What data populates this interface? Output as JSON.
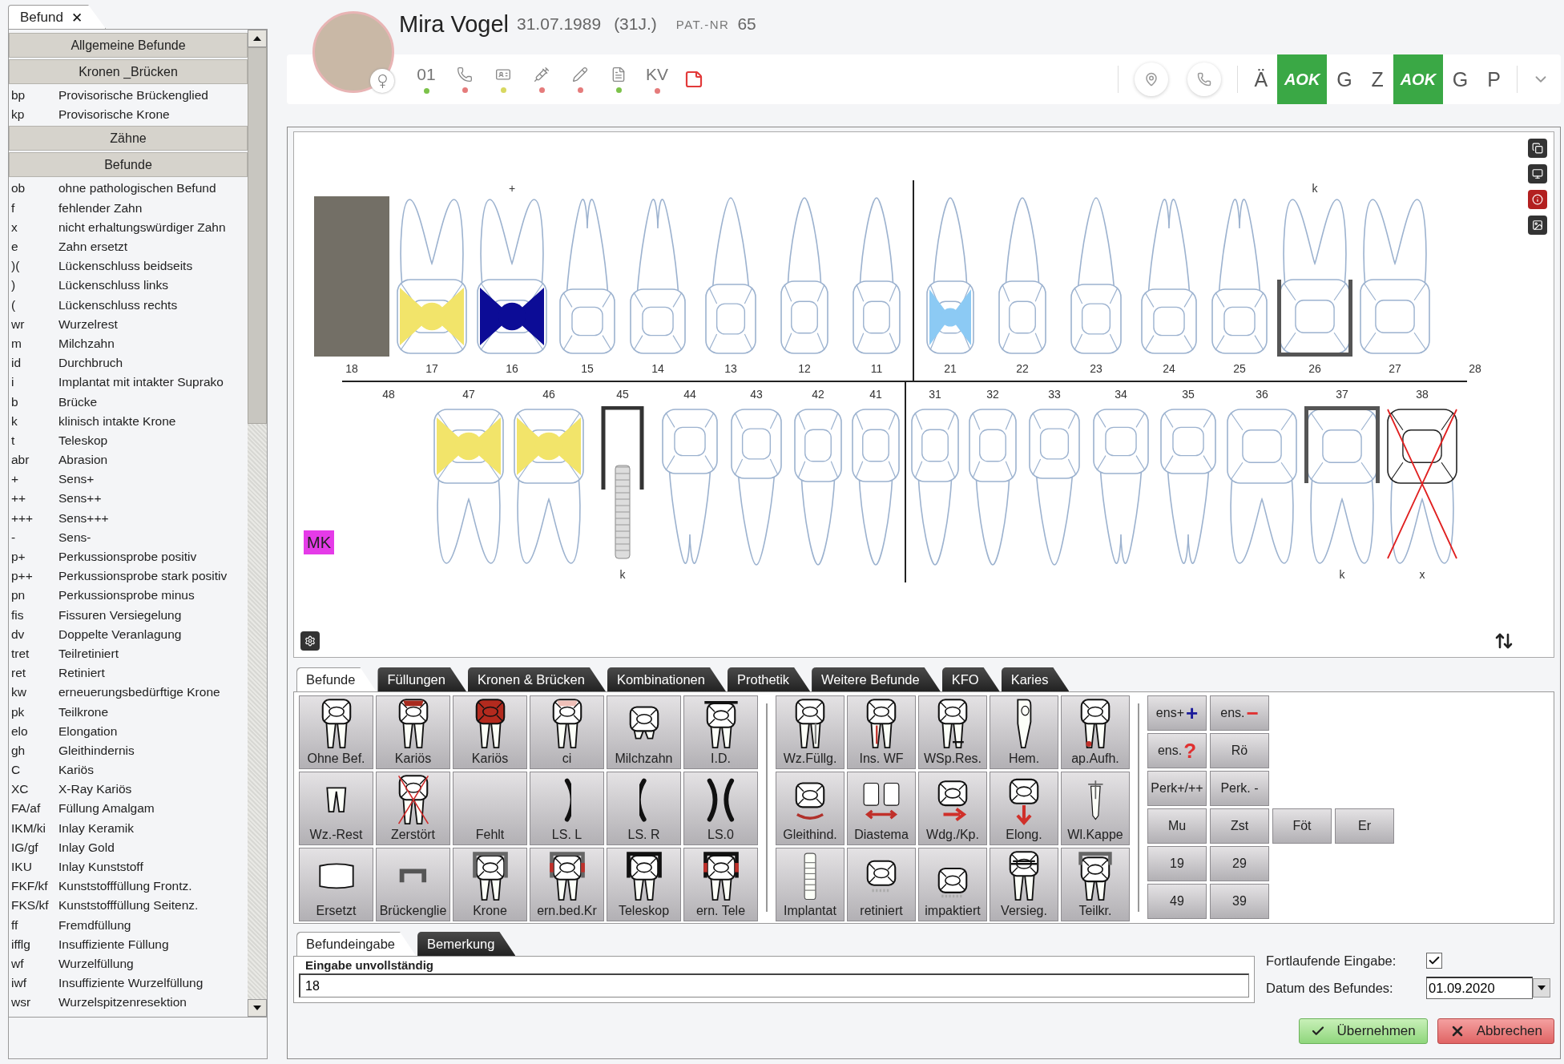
{
  "sidebar": {
    "tab": {
      "label": "Befund",
      "close": "✕"
    },
    "sections": [
      {
        "title": "Allgemeine Befunde"
      },
      {
        "title": "Kronen _Brücken",
        "items": [
          {
            "code": "bp",
            "label": "Provisorische Brückenglied"
          },
          {
            "code": "kp",
            "label": "Provisorische Krone"
          }
        ]
      },
      {
        "title": "Zähne"
      },
      {
        "title": "Befunde",
        "items": [
          {
            "code": "ob",
            "label": "ohne pathologischen Befund"
          },
          {
            "code": "f",
            "label": "fehlender Zahn"
          },
          {
            "code": "x",
            "label": "nicht erhaltungswürdiger Zahn"
          },
          {
            "code": "e",
            "label": "Zahn ersetzt"
          },
          {
            "code": ")(",
            "label": "Lückenschluss beidseits"
          },
          {
            "code": ")",
            "label": "Lückenschluss links"
          },
          {
            "code": "(",
            "label": "Lückenschluss rechts"
          },
          {
            "code": "wr",
            "label": "Wurzelrest"
          },
          {
            "code": "m",
            "label": "Milchzahn"
          },
          {
            "code": "id",
            "label": "Durchbruch"
          },
          {
            "code": "i",
            "label": "Implantat mit intakter Suprako"
          },
          {
            "code": "b",
            "label": "Brücke"
          },
          {
            "code": "k",
            "label": "klinisch intakte Krone"
          },
          {
            "code": "t",
            "label": "Teleskop"
          },
          {
            "code": "abr",
            "label": "Abrasion"
          },
          {
            "code": "+",
            "label": "Sens+"
          },
          {
            "code": "++",
            "label": "Sens++"
          },
          {
            "code": "+++",
            "label": "Sens+++"
          },
          {
            "code": "-",
            "label": "Sens-"
          },
          {
            "code": "p+",
            "label": "Perkussionsprobe positiv"
          },
          {
            "code": "p++",
            "label": "Perkussionsprobe stark positiv"
          },
          {
            "code": "pn",
            "label": "Perkussionsprobe minus"
          },
          {
            "code": "fis",
            "label": "Fissuren Versiegelung"
          },
          {
            "code": "dv",
            "label": "Doppelte Veranlagung"
          },
          {
            "code": "tret",
            "label": "Teilretiniert"
          },
          {
            "code": "ret",
            "label": "Retiniert"
          },
          {
            "code": "kw",
            "label": "erneuerungsbedürftige Krone"
          },
          {
            "code": "pk",
            "label": "Teilkrone"
          },
          {
            "code": "elo",
            "label": "Elongation"
          },
          {
            "code": "gh",
            "label": "Gleithindernis"
          },
          {
            "code": "C",
            "label": "Kariös"
          },
          {
            "code": "XC",
            "label": "X-Ray Kariös"
          },
          {
            "code": "FA/af",
            "label": "Füllung Amalgam"
          },
          {
            "code": "IKM/ki",
            "label": "Inlay Keramik"
          },
          {
            "code": "IG/gf",
            "label": "Inlay Gold"
          },
          {
            "code": "IKU",
            "label": "Inlay Kunststoff"
          },
          {
            "code": "FKF/kf",
            "label": "Kunststofffüllung Frontz."
          },
          {
            "code": "FKS/kf",
            "label": "Kunststofffüllung Seitenz."
          },
          {
            "code": "ff",
            "label": "Fremdfüllung"
          },
          {
            "code": "ifflg",
            "label": "Insuffiziente Füllung"
          },
          {
            "code": "wf",
            "label": "Wurzelfüllung"
          },
          {
            "code": "iwf",
            "label": "Insuffiziente Wurzelfüllung"
          },
          {
            "code": "wsr",
            "label": "Wurzelspitzenresektion"
          }
        ]
      }
    ]
  },
  "patient": {
    "name": "Mira Vogel",
    "birth_date": "31.07.1989",
    "age": "(31J.)",
    "number_label": "PAT.-NR",
    "number": "65"
  },
  "toolbar": {
    "items": [
      {
        "label": "01",
        "color": "#7cc24a"
      },
      {
        "color": "#e57b7b"
      },
      {
        "color": "#d8d860"
      },
      {
        "color": "#e57b7b"
      },
      {
        "color": "#e57b7b"
      },
      {
        "color": "#7cc24a"
      },
      {
        "label": "KV",
        "color": "#e57b7b"
      }
    ],
    "insurance": [
      {
        "kind": "letter",
        "label": "Ä"
      },
      {
        "kind": "logo",
        "label": "AOK"
      },
      {
        "kind": "letter",
        "label": "G"
      },
      {
        "kind": "letter",
        "label": "Z"
      },
      {
        "kind": "logo",
        "label": "AOK"
      },
      {
        "kind": "letter",
        "label": "G"
      },
      {
        "kind": "letter",
        "label": "P"
      }
    ]
  },
  "chart": {
    "badge": "MK",
    "upper_jaw": {
      "right": [
        {
          "number": "18",
          "kind": "marked"
        },
        {
          "number": "17",
          "kind": "filling",
          "color": "#f2e46a"
        },
        {
          "number": "16",
          "kind": "filling",
          "color": "#0c0c96",
          "mark": "+"
        },
        {
          "number": "15",
          "kind": "healthy"
        },
        {
          "number": "14",
          "kind": "healthy"
        },
        {
          "number": "13",
          "kind": "healthy"
        },
        {
          "number": "12",
          "kind": "healthy"
        },
        {
          "number": "11",
          "kind": "healthy"
        }
      ],
      "left": [
        {
          "number": "21",
          "kind": "filling",
          "color": "#8ccaf4"
        },
        {
          "number": "22",
          "kind": "healthy"
        },
        {
          "number": "23",
          "kind": "healthy"
        },
        {
          "number": "24",
          "kind": "healthy"
        },
        {
          "number": "25",
          "kind": "healthy"
        },
        {
          "number": "26",
          "kind": "crown",
          "mark": "k"
        },
        {
          "number": "27",
          "kind": "healthy"
        },
        {
          "number": "28",
          "kind": "missing"
        }
      ]
    },
    "lower_jaw": {
      "right": [
        {
          "number": "48",
          "kind": "missing"
        },
        {
          "number": "47",
          "kind": "filling",
          "color": "#f2e46a"
        },
        {
          "number": "46",
          "kind": "filling",
          "color": "#f2e46a"
        },
        {
          "number": "45",
          "kind": "implant",
          "mark": "k"
        },
        {
          "number": "44",
          "kind": "healthy"
        },
        {
          "number": "43",
          "kind": "healthy"
        },
        {
          "number": "42",
          "kind": "healthy"
        },
        {
          "number": "41",
          "kind": "healthy"
        }
      ],
      "left": [
        {
          "number": "31",
          "kind": "healthy"
        },
        {
          "number": "32",
          "kind": "healthy"
        },
        {
          "number": "33",
          "kind": "healthy"
        },
        {
          "number": "34",
          "kind": "healthy"
        },
        {
          "number": "35",
          "kind": "healthy"
        },
        {
          "number": "36",
          "kind": "healthy"
        },
        {
          "number": "37",
          "kind": "crown",
          "mark": "k"
        },
        {
          "number": "38",
          "kind": "extraction",
          "mark": "x"
        }
      ]
    }
  },
  "tabs": [
    {
      "label": "Befunde",
      "selected": true
    },
    {
      "label": "Füllungen",
      "selected": false
    },
    {
      "label": "Kronen & Brücken",
      "selected": false
    },
    {
      "label": "Kombinationen",
      "selected": false
    },
    {
      "label": "Prothetik",
      "selected": false
    },
    {
      "label": "Weitere Befunde",
      "selected": false
    },
    {
      "label": "KFO",
      "selected": false
    },
    {
      "label": "Karies",
      "selected": false
    }
  ],
  "finding_buttons": [
    {
      "label": "Ohne Bef.",
      "kind": "tooth"
    },
    {
      "label": "Kariös",
      "kind": "caries-top"
    },
    {
      "label": "Kariös",
      "kind": "caries-full"
    },
    {
      "label": "ci",
      "kind": "ci"
    },
    {
      "label": "Milchzahn",
      "kind": "milk"
    },
    {
      "label": "I.D.",
      "kind": "id"
    },
    {
      "label": "Wz.-Rest",
      "kind": "root-rest"
    },
    {
      "label": "Zerstört",
      "kind": "destroyed"
    },
    {
      "label": "Fehlt",
      "kind": "empty"
    },
    {
      "label": "LS. L",
      "kind": "close-left"
    },
    {
      "label": "LS. R",
      "kind": "close-right"
    },
    {
      "label": "LS.0",
      "kind": "close-both"
    },
    {
      "label": "Ersetzt",
      "kind": "replaced"
    },
    {
      "label": "Brückenglie",
      "kind": "bridge-link"
    },
    {
      "label": "Krone",
      "kind": "crown"
    },
    {
      "label": "ern.bed.Kr",
      "kind": "crown-renew"
    },
    {
      "label": "Teleskop",
      "kind": "telescope"
    },
    {
      "label": "ern. Tele",
      "kind": "telescope-renew"
    }
  ],
  "more_buttons": [
    {
      "label": "Wz.Füllg.",
      "kind": "root-fill"
    },
    {
      "label": "Ins. WF",
      "kind": "root-fill-bad"
    },
    {
      "label": "WSp.Res.",
      "kind": "resection"
    },
    {
      "label": "Hem.",
      "kind": "hemisection"
    },
    {
      "label": "ap.Aufh.",
      "kind": "apex"
    },
    {
      "label": "Gleithind.",
      "kind": "glide"
    },
    {
      "label": "Diastema",
      "kind": "diastema"
    },
    {
      "label": "Wdg./Kp.",
      "kind": "tilt"
    },
    {
      "label": "Elong.",
      "kind": "elongation"
    },
    {
      "label": "Wl.Kappe",
      "kind": "cap"
    },
    {
      "label": "Implantat",
      "kind": "implant"
    },
    {
      "label": "retiniert",
      "kind": "retained"
    },
    {
      "label": "impaktiert",
      "kind": "impacted"
    },
    {
      "label": "Versieg.",
      "kind": "sealed"
    },
    {
      "label": "Teilkr.",
      "kind": "partial-crown"
    }
  ],
  "quick_buttons": [
    [
      {
        "label": "ens+",
        "symbol": "+",
        "color": "#1a1a9a"
      },
      {
        "label": "ens.",
        "symbol": "−",
        "color": "#e03030"
      }
    ],
    [
      {
        "label": "ens.",
        "symbol": "?",
        "color": "#e03030"
      },
      {
        "label": "Rö"
      }
    ],
    [
      {
        "label": "Perk+/++"
      },
      {
        "label": "Perk. -"
      }
    ],
    [
      {
        "label": "Mu"
      },
      {
        "label": "Zst"
      },
      {
        "label": "Föt"
      },
      {
        "label": "Er"
      }
    ],
    [
      {
        "label": "19"
      },
      {
        "label": "29"
      }
    ],
    [
      {
        "label": "49"
      },
      {
        "label": "39"
      }
    ]
  ],
  "entry": {
    "tabs": [
      {
        "label": "Befundeingabe",
        "selected": true
      },
      {
        "label": "Bemerkung",
        "selected": false
      }
    ],
    "status": "Eingabe unvollständig",
    "value": "18"
  },
  "options": {
    "continuous_label": "Fortlaufende Eingabe:",
    "continuous": true,
    "date_label": "Datum des Befundes:",
    "date": "01.09.2020"
  },
  "buttons": [
    {
      "kind": "ok",
      "label": "Übernehmen"
    },
    {
      "kind": "cancel",
      "label": "Abbrechen"
    }
  ]
}
